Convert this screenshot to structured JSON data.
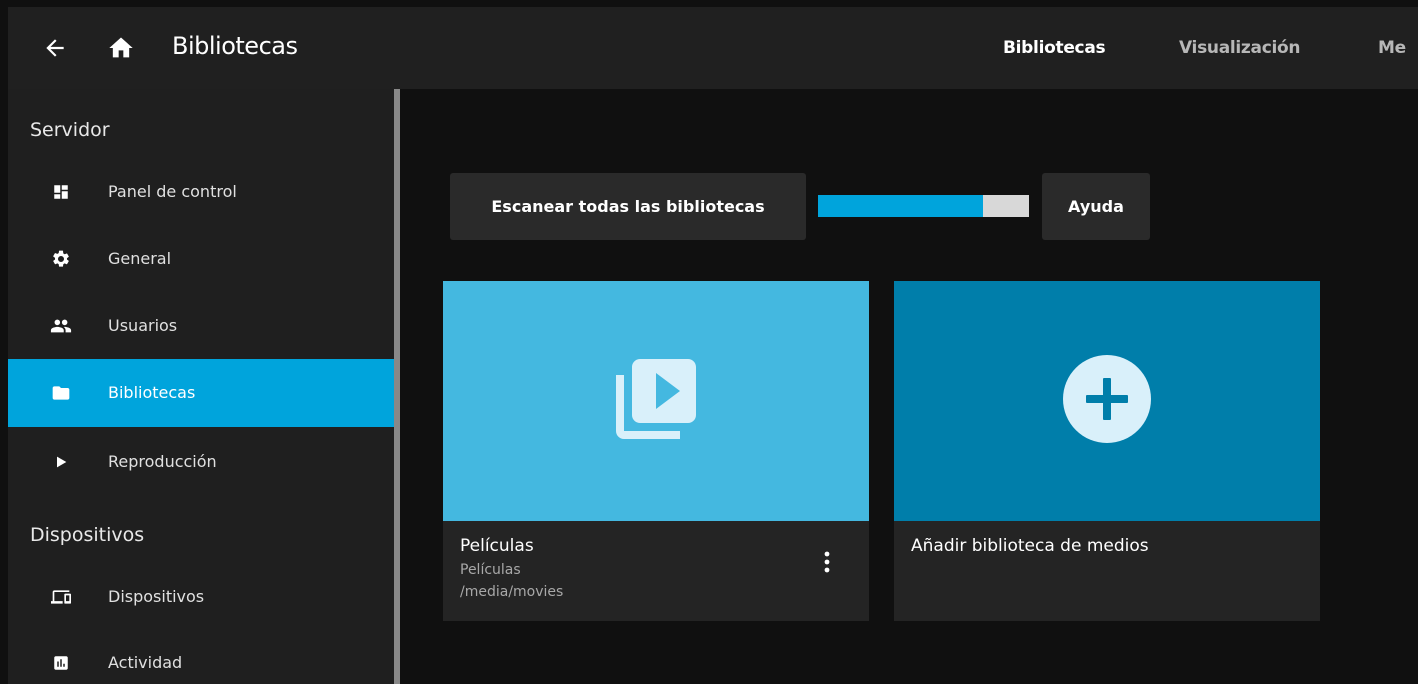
{
  "header": {
    "title": "Bibliotecas",
    "tabs": [
      {
        "label": "Bibliotecas"
      },
      {
        "label": "Visualización"
      },
      {
        "label": "Me"
      }
    ],
    "icons": {
      "back": "arrow-back-icon",
      "home": "home-icon"
    }
  },
  "sidebar": {
    "sections": [
      {
        "label": "Servidor"
      },
      {
        "label": "Dispositivos"
      }
    ],
    "items": [
      {
        "label": "Panel de control",
        "icon": "dashboard-icon"
      },
      {
        "label": "General",
        "icon": "gear-icon"
      },
      {
        "label": "Usuarios",
        "icon": "users-icon"
      },
      {
        "label": "Bibliotecas",
        "icon": "folder-icon",
        "active": true
      },
      {
        "label": "Reproducción",
        "icon": "play-icon"
      },
      {
        "label": "Dispositivos",
        "icon": "devices-icon"
      },
      {
        "label": "Actividad",
        "icon": "activity-icon"
      }
    ]
  },
  "main": {
    "scan_button": "Escanear todas las bibliotecas",
    "help_button": "Ayuda",
    "scan_progress": 0.78,
    "cards": [
      {
        "title": "Películas",
        "type": "Películas",
        "path": "/media/movies",
        "icon": "video-library-icon"
      },
      {
        "title": "Añadir biblioteca de medios",
        "icon": "add-circle-icon"
      }
    ]
  },
  "colors": {
    "accent": "#00a4dc",
    "header_bg": "#202020",
    "sidebar_bg": "#1f1f1f",
    "page_bg": "#101010",
    "card_movies": "#44b8e0",
    "card_add": "#007eaa"
  }
}
